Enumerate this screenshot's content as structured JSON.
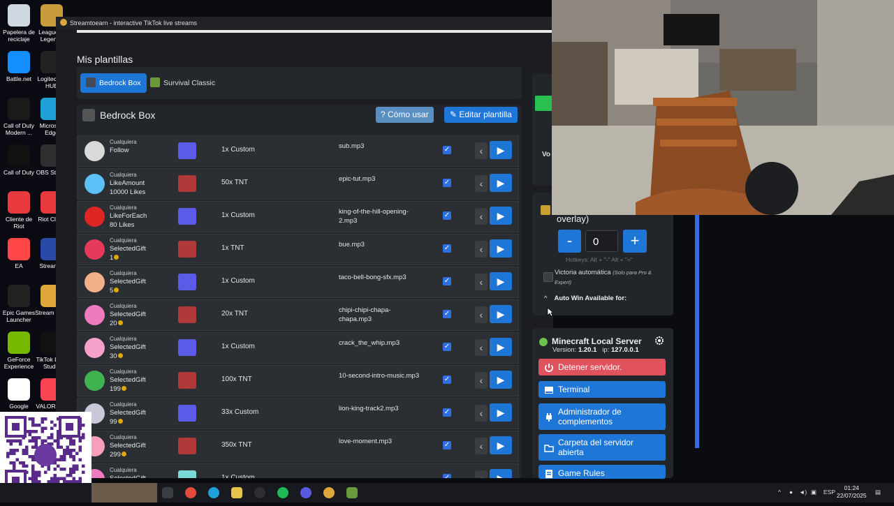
{
  "window": {
    "title": "Streamtoearn - interactive TikTok live streams"
  },
  "desktop": {
    "icons": [
      {
        "label": "Papelera de reciclaje",
        "color": "#cfd8e0"
      },
      {
        "label": "League of Legends",
        "color": "#c89b3c"
      },
      {
        "label": "Battle.net",
        "color": "#148eff"
      },
      {
        "label": "Logitech G HUB",
        "color": "#222222"
      },
      {
        "label": "Call of Duty Modern ...",
        "color": "#1a1a1a"
      },
      {
        "label": "Microsoft Edge",
        "color": "#1fa0d8"
      },
      {
        "label": "Call of Duty",
        "color": "#111111"
      },
      {
        "label": "OBS Studio",
        "color": "#302e31"
      },
      {
        "label": "Cliente de Riot",
        "color": "#e8393d"
      },
      {
        "label": "Riot Client",
        "color": "#e8393d"
      },
      {
        "label": "EA",
        "color": "#ff4747"
      },
      {
        "label": "Streamer",
        "color": "#2b4aa8"
      },
      {
        "label": "Epic Games Launcher",
        "color": "#222222"
      },
      {
        "label": "Stream Earn",
        "color": "#e0a63a"
      },
      {
        "label": "GeForce Experience",
        "color": "#76b900"
      },
      {
        "label": "TikTok LIVE Studio",
        "color": "#111111"
      },
      {
        "label": "Google",
        "color": "#ffffff"
      },
      {
        "label": "VALORANT",
        "color": "#fa4454"
      }
    ]
  },
  "templates": {
    "heading": "Mis plantillas",
    "tabs": [
      {
        "label": "Bedrock Box",
        "active": true
      },
      {
        "label": "Survival Classic",
        "active": false
      }
    ]
  },
  "panel": {
    "title": "Bedrock Box",
    "help_label": "Cómo usar",
    "edit_label": "Editar plantilla",
    "rows": [
      {
        "who": "Cualquiera",
        "event": "Follow",
        "detail": "",
        "coin": false,
        "action": "1x Custom",
        "sound": "sub.mp3",
        "avatar": "#d9d9d9",
        "block": "#5b5be8"
      },
      {
        "who": "Cualquiera",
        "event": "LikeAmount",
        "detail": "10000 Likes",
        "coin": false,
        "action": "50x TNT",
        "sound": "epic-tut.mp3",
        "avatar": "#5bc0f5",
        "block": "#b03a3a"
      },
      {
        "who": "Cualquiera",
        "event": "LikeForEach",
        "detail": "80 Likes",
        "coin": false,
        "action": "1x Custom",
        "sound": "king-of-the-hill-opening-2.mp3",
        "avatar": "#e02525",
        "block": "#5b5be8"
      },
      {
        "who": "Cualquiera",
        "event": "SelectedGift",
        "detail": "1",
        "coin": true,
        "action": "1x TNT",
        "sound": "bue.mp3",
        "avatar": "#e63a5a",
        "block": "#b03a3a"
      },
      {
        "who": "Cualquiera",
        "event": "SelectedGift",
        "detail": "5",
        "coin": true,
        "action": "1x Custom",
        "sound": "taco-bell-bong-sfx.mp3",
        "avatar": "#f2b08a",
        "block": "#5b5be8"
      },
      {
        "who": "Cualquiera",
        "event": "SelectedGift",
        "detail": "20",
        "coin": true,
        "action": "20x TNT",
        "sound": "chipi-chipi-chapa-chapa.mp3",
        "avatar": "#f07ac0",
        "block": "#b03a3a"
      },
      {
        "who": "Cualquiera",
        "event": "SelectedGift",
        "detail": "30",
        "coin": true,
        "action": "1x Custom",
        "sound": "crack_the_whip.mp3",
        "avatar": "#f5a0c8",
        "block": "#5b5be8"
      },
      {
        "who": "Cualquiera",
        "event": "SelectedGift",
        "detail": "199",
        "coin": true,
        "action": "100x TNT",
        "sound": "10-second-intro-music.mp3",
        "avatar": "#3fb34f",
        "block": "#b03a3a"
      },
      {
        "who": "Cualquiera",
        "event": "SelectedGift",
        "detail": "99",
        "coin": true,
        "action": "33x Custom",
        "sound": "lion-king-track2.mp3",
        "avatar": "#c8c8d8",
        "block": "#5b5be8"
      },
      {
        "who": "Cualquiera",
        "event": "SelectedGift",
        "detail": "299",
        "coin": true,
        "action": "350x TNT",
        "sound": "love-moment.mp3",
        "avatar": "#f5a0b8",
        "block": "#b03a3a"
      },
      {
        "who": "Cualquiera",
        "event": "SelectedGift",
        "detail": "",
        "coin": false,
        "action": "1x Custom",
        "sound": "",
        "avatar": "#f07ac0",
        "block": "#7ad8d8"
      }
    ]
  },
  "counter": {
    "overlay_label": "overlay)",
    "minus": "-",
    "value": "0",
    "plus": "+",
    "hotkeys": "Hotkeys: Alt + \"-\" Alt + \"=\"",
    "autowin_label": "Victoria automática",
    "autowin_note": "(Solo para Pro & Expert)",
    "autowin_for": "Auto Win Available for:",
    "behind_label": "Vo"
  },
  "server": {
    "title": "Minecraft Local Server",
    "version_label": "Version:",
    "version": "1.20.1",
    "ip_label": "ip:",
    "ip": "127.0.0.1",
    "status_color": "#6ec34a",
    "stop_label": "Detener servidor.",
    "terminal_label": "Terminal",
    "addons_label": "Administrador de complementos",
    "folder_label": "Carpeta del servidor abierta",
    "rules_label": "Game Rules"
  },
  "taskbar": {
    "lang": "ESP",
    "time": "01:24",
    "date": "22/07/2025"
  },
  "colors": {
    "accent": "#1e77d6",
    "danger": "#e0535e",
    "online": "#6ec34a"
  }
}
